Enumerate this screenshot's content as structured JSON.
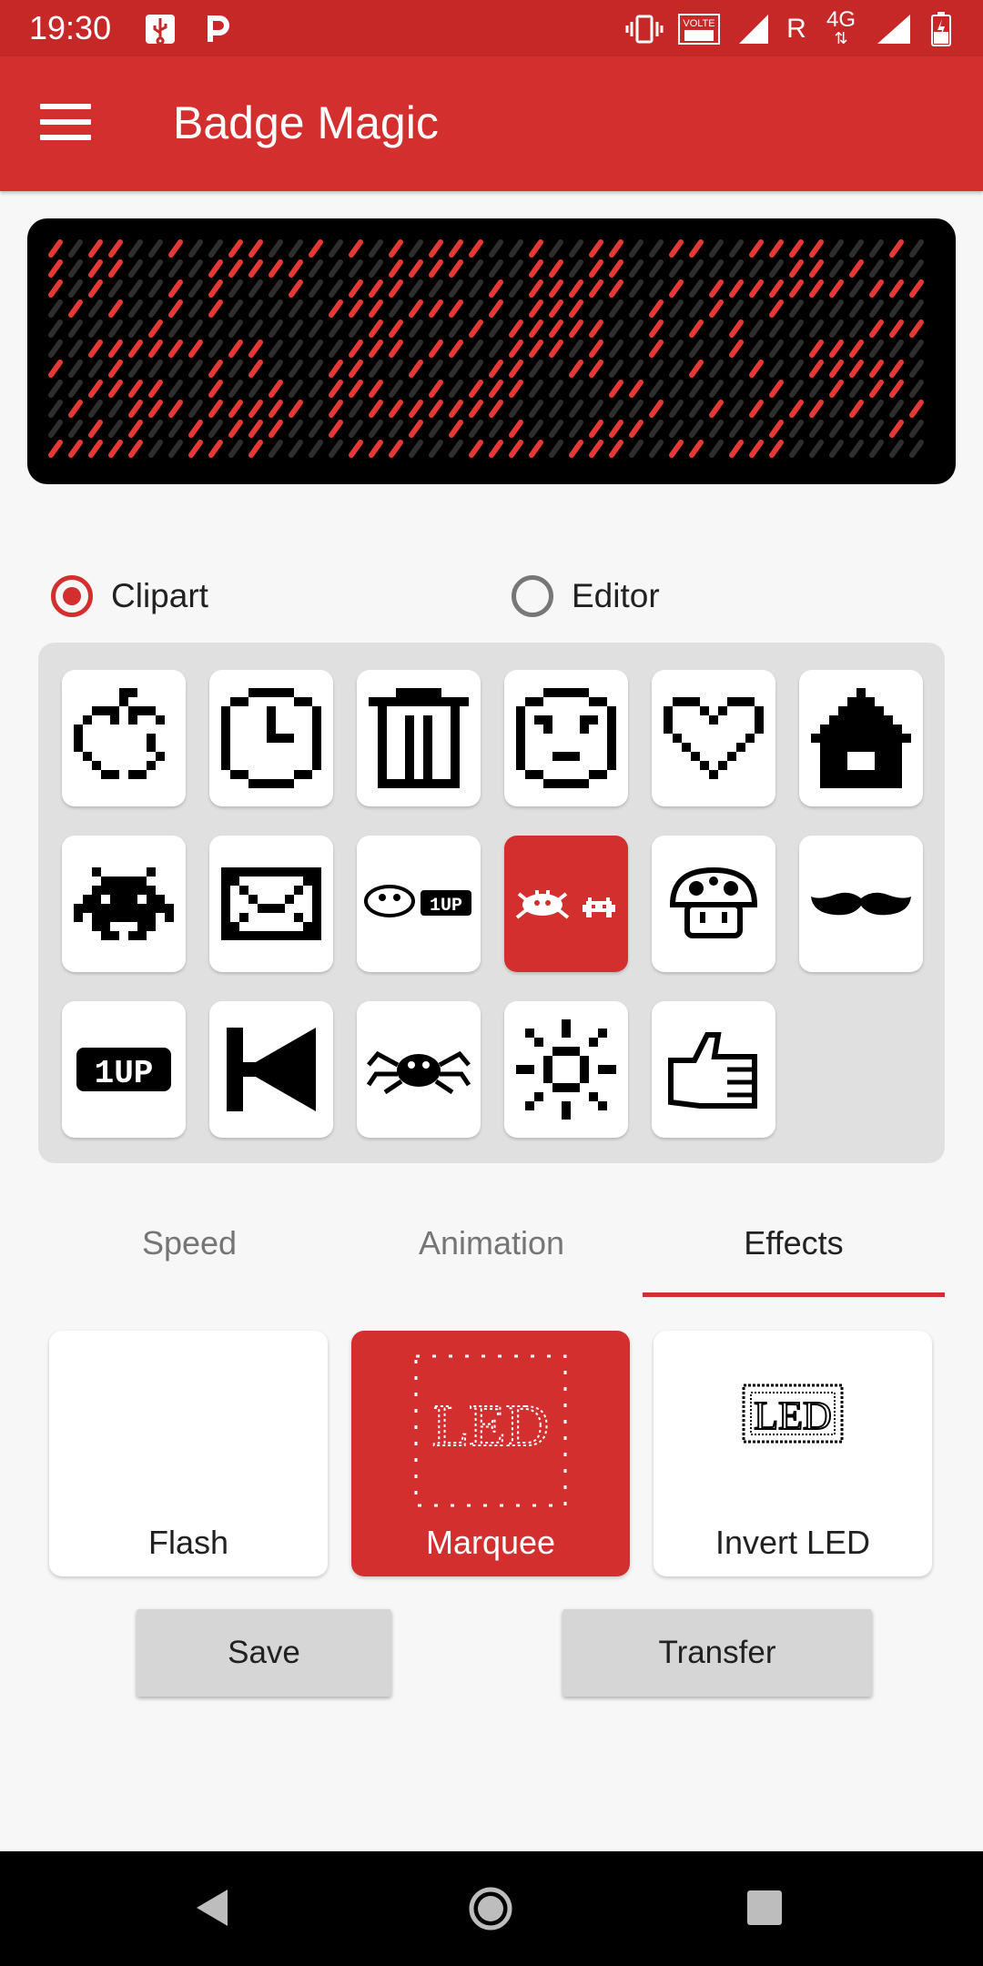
{
  "status_bar": {
    "time": "19:30",
    "network_label": "4G",
    "roaming_label": "R",
    "volte_label": "VOLTE"
  },
  "app_bar": {
    "title": "Badge Magic"
  },
  "mode_selector": {
    "options": [
      {
        "label": "Clipart",
        "selected": true
      },
      {
        "label": "Editor",
        "selected": false
      }
    ]
  },
  "clipart": {
    "items": [
      {
        "icon": "apple-icon",
        "selected": false
      },
      {
        "icon": "clock-icon",
        "selected": false
      },
      {
        "icon": "trash-icon",
        "selected": false
      },
      {
        "icon": "face-icon",
        "selected": false
      },
      {
        "icon": "heart-icon",
        "selected": false
      },
      {
        "icon": "house-icon",
        "selected": false
      },
      {
        "icon": "space-invader-icon",
        "selected": false
      },
      {
        "icon": "envelope-icon",
        "selected": false
      },
      {
        "icon": "mushroom-1up-icon",
        "selected": false
      },
      {
        "icon": "crab-invader-icon",
        "selected": true
      },
      {
        "icon": "mushroom-icon",
        "selected": false
      },
      {
        "icon": "mustache-icon",
        "selected": false
      },
      {
        "icon": "1up-icon",
        "selected": false
      },
      {
        "icon": "bowtie-icon",
        "selected": false
      },
      {
        "icon": "spider-icon",
        "selected": false
      },
      {
        "icon": "sun-icon",
        "selected": false
      },
      {
        "icon": "thumbs-up-icon",
        "selected": false
      }
    ],
    "embedded_text": {
      "one_up": "1UP"
    }
  },
  "tabs": {
    "items": [
      {
        "label": "Speed",
        "active": false
      },
      {
        "label": "Animation",
        "active": false
      },
      {
        "label": "Effects",
        "active": true
      }
    ]
  },
  "effects": {
    "items": [
      {
        "label": "Flash",
        "selected": false
      },
      {
        "label": "Marquee",
        "selected": true,
        "preview_text": "LED"
      },
      {
        "label": "Invert LED",
        "selected": false,
        "preview_text": "LED"
      }
    ]
  },
  "actions": {
    "save_label": "Save",
    "transfer_label": "Transfer"
  },
  "colors": {
    "primary": "#d32f2f",
    "status_bar": "#c62828",
    "led_on": "#e53935",
    "led_off": "#2e2e2e"
  }
}
